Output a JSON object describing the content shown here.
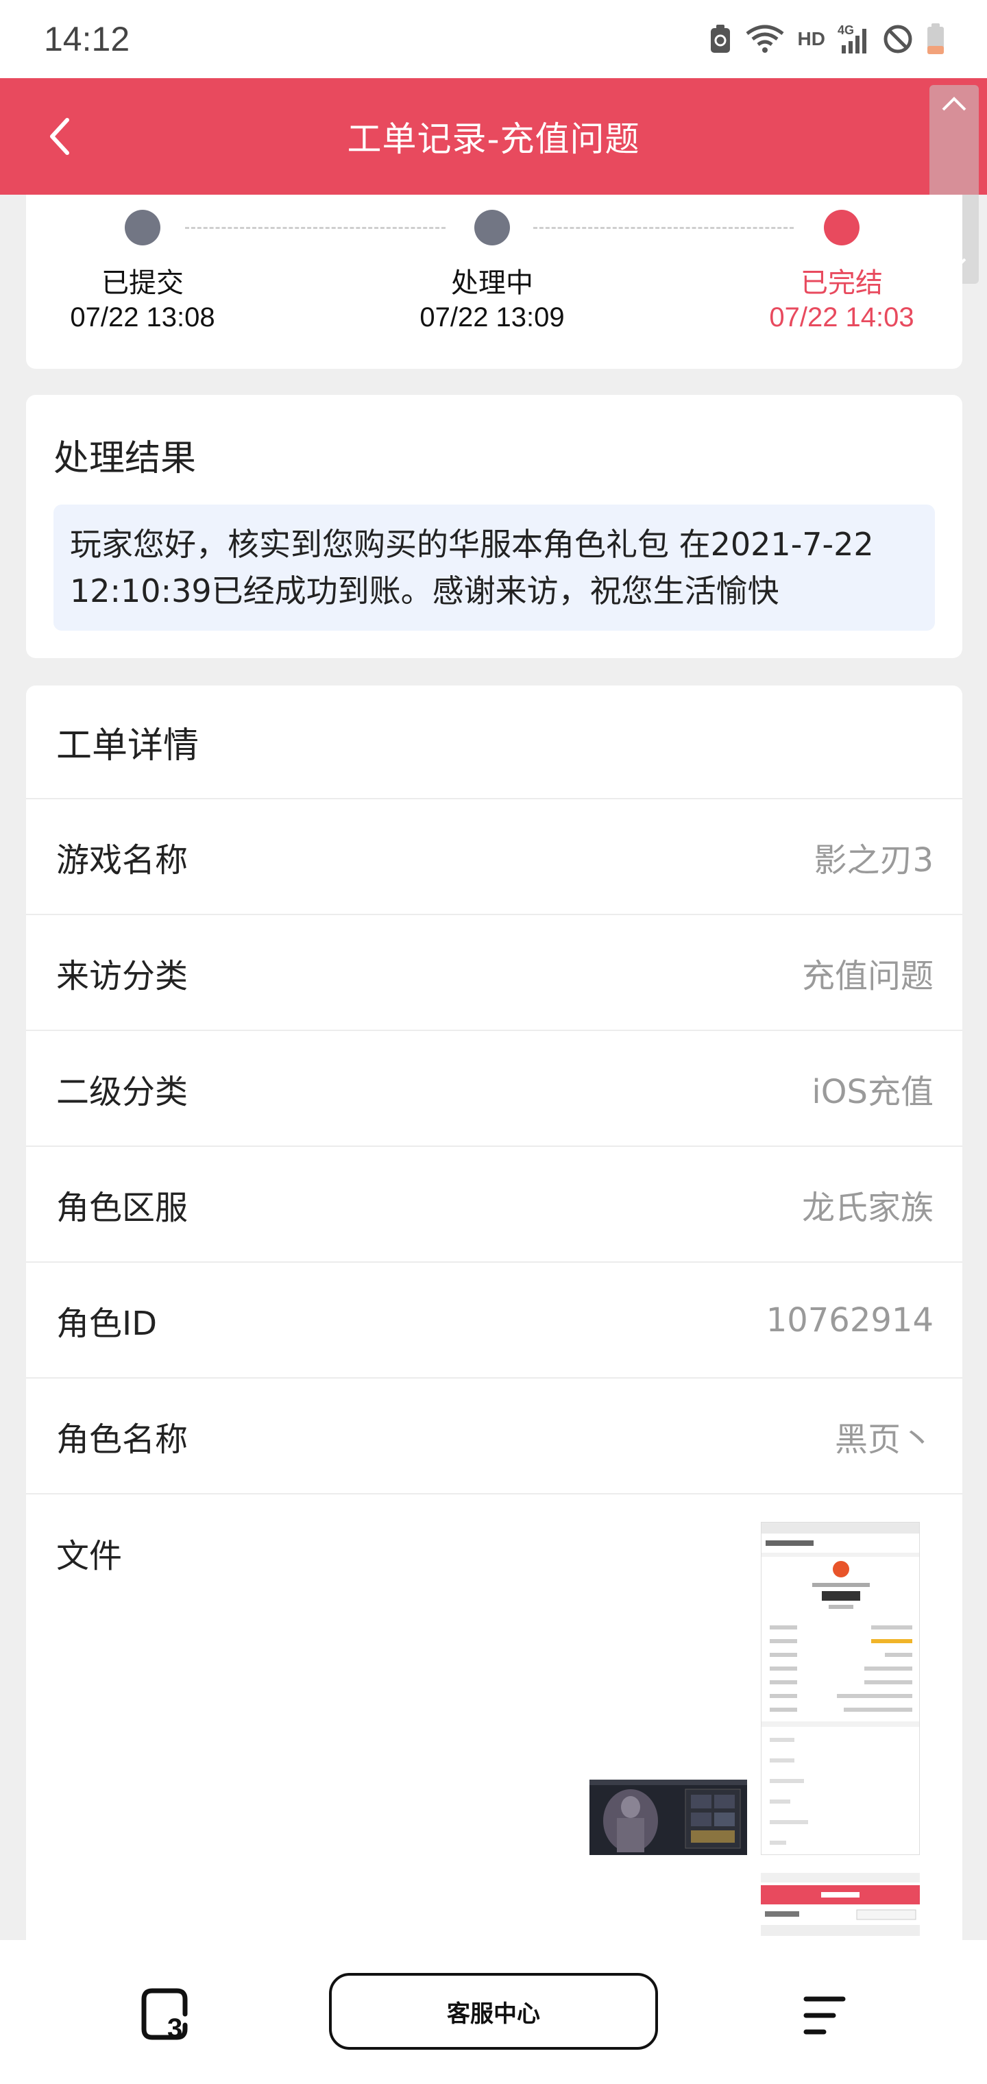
{
  "status_bar": {
    "time": "14:12",
    "network_label": "HD"
  },
  "header": {
    "title": "工单记录-充值问题"
  },
  "progress": {
    "steps": [
      {
        "label": "已提交",
        "time": "07/22 13:08"
      },
      {
        "label": "处理中",
        "time": "07/22 13:09"
      },
      {
        "label": "已完结",
        "time": "07/22 14:03"
      }
    ]
  },
  "result": {
    "title": "处理结果",
    "line1": "玩家您好，核实到您购买的华服本角色礼包 在2021-7-22",
    "line2": "12:10:39已经成功到账。感谢来访，祝您生活愉快"
  },
  "details": {
    "title": "工单详情",
    "rows": [
      {
        "key": "游戏名称",
        "value": "影之刃3"
      },
      {
        "key": "来访分类",
        "value": "充值问题"
      },
      {
        "key": "二级分类",
        "value": "iOS充值"
      },
      {
        "key": "角色区服",
        "value": "龙氏家族"
      },
      {
        "key": "角色ID",
        "value": "10762914"
      },
      {
        "key": "角色名称",
        "value": "黑页丶"
      }
    ],
    "files_label": "文件"
  },
  "bottom_bar": {
    "service_label": "客服中心"
  },
  "colors": {
    "accent": "#e84a5e",
    "step_dot": "#727684",
    "result_bg": "#eef3fd",
    "page_bg": "#efefef"
  },
  "icons": {
    "back": "chevron-left-icon",
    "battery_saver": "battery-saver-icon",
    "wifi": "wifi-icon",
    "signal": "signal-4g-icon",
    "dnd": "do-not-disturb-icon",
    "battery": "battery-low-icon",
    "home": "game-home-icon",
    "menu": "menu-icon"
  }
}
